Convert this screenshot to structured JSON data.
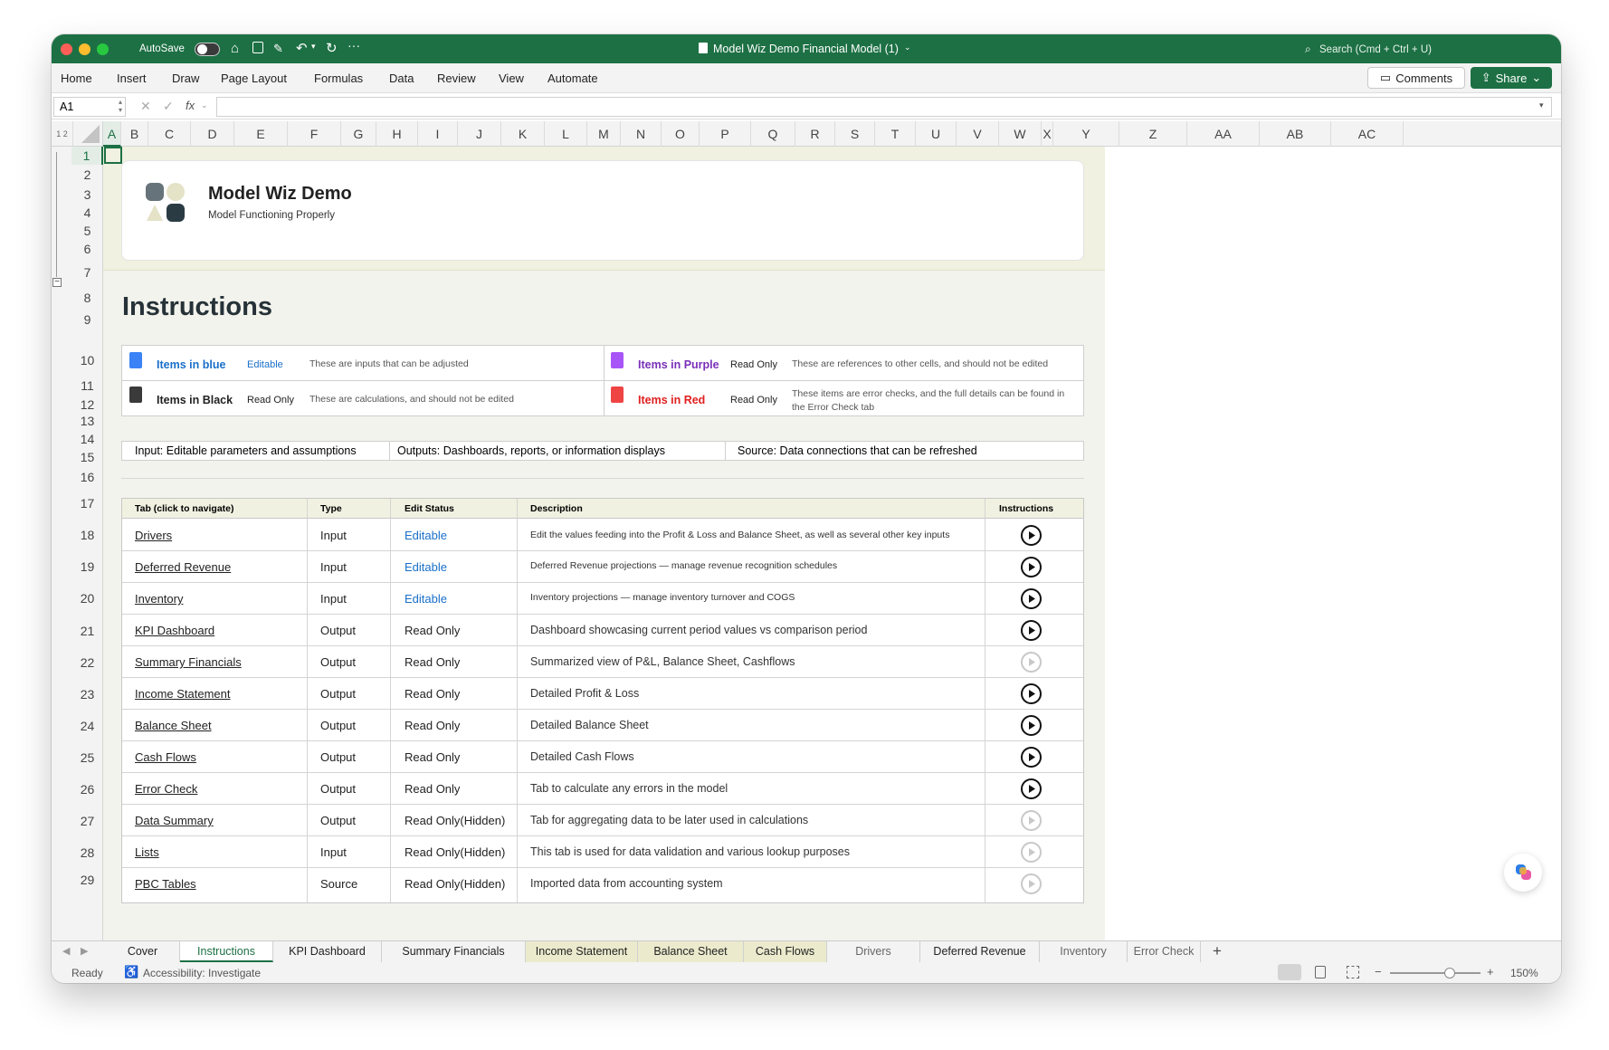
{
  "window": {
    "title": "Model Wiz Demo Financial Model (1)",
    "autosave_label": "AutoSave",
    "search_placeholder": "Search (Cmd + Ctrl + U)"
  },
  "menu": [
    "Home",
    "Insert",
    "Draw",
    "Page Layout",
    "Formulas",
    "Data",
    "Review",
    "View",
    "Automate"
  ],
  "ribbon": {
    "comments_label": "Comments",
    "share_label": "Share"
  },
  "formula_bar": {
    "cell_ref": "A1",
    "fx_label": "fx",
    "value": ""
  },
  "columns": [
    "A",
    "B",
    "C",
    "D",
    "E",
    "F",
    "G",
    "H",
    "I",
    "J",
    "K",
    "L",
    "M",
    "N",
    "O",
    "P",
    "Q",
    "R",
    "S",
    "T",
    "U",
    "V",
    "W",
    "X",
    "Y",
    "Z",
    "AA",
    "AB",
    "AC"
  ],
  "rows": [
    "1",
    "2",
    "3",
    "4",
    "5",
    "6",
    "7",
    "8",
    "9",
    "10",
    "11",
    "12",
    "13",
    "14",
    "15",
    "16",
    "17",
    "18",
    "19",
    "20",
    "21",
    "22",
    "23",
    "24",
    "25",
    "26",
    "27",
    "28",
    "29"
  ],
  "outline_levels": [
    "1",
    "2"
  ],
  "header_card": {
    "title": "Model Wiz Demo",
    "subtitle": "Model Functioning Properly"
  },
  "instructions": {
    "heading": "Instructions",
    "legend": [
      {
        "label": "Items in blue",
        "status": "Editable",
        "desc": "These are inputs that can be adjusted",
        "color": "#1a6fc9"
      },
      {
        "label": "Items in Purple",
        "status": "Read Only",
        "desc": "These are references to other cells, and should not be edited",
        "color": "#7a2fb8"
      },
      {
        "label": "Items in Black",
        "status": "Read Only",
        "desc": "These are calculations, and should not be edited",
        "color": "#222222"
      },
      {
        "label": "Items in Red",
        "status": "Read Only",
        "desc": "These items are error checks, and the full details can be found in the Error Check tab",
        "color": "#e02020"
      }
    ],
    "categories": [
      "Input: Editable parameters and assumptions",
      "Outputs: Dashboards, reports, or information displays",
      "Source: Data connections that can be refreshed"
    ]
  },
  "table": {
    "headers": [
      "Tab (click to navigate)",
      "Type",
      "Edit Status",
      "Description",
      "Instructions"
    ],
    "rows": [
      {
        "tab": "Drivers",
        "type": "Input",
        "status": "Editable",
        "desc": "Edit the values feeding into the Profit & Loss and Balance Sheet, as well as several other key inputs",
        "video": true
      },
      {
        "tab": "Deferred Revenue",
        "type": "Input",
        "status": "Editable",
        "desc": "Deferred Revenue projections — manage revenue recognition schedules",
        "video": true
      },
      {
        "tab": "Inventory",
        "type": "Input",
        "status": "Editable",
        "desc": "Inventory projections — manage inventory turnover and COGS",
        "video": true
      },
      {
        "tab": "KPI Dashboard",
        "type": "Output",
        "status": "Read Only",
        "desc": "Dashboard showcasing current period values vs comparison period",
        "video": true
      },
      {
        "tab": "Summary Financials",
        "type": "Output",
        "status": "Read Only",
        "desc": "Summarized view of P&L, Balance Sheet, Cashflows",
        "video": false
      },
      {
        "tab": "Income Statement",
        "type": "Output",
        "status": "Read Only",
        "desc": "Detailed Profit & Loss",
        "video": true
      },
      {
        "tab": "Balance Sheet",
        "type": "Output",
        "status": "Read Only",
        "desc": "Detailed Balance Sheet",
        "video": true
      },
      {
        "tab": "Cash Flows",
        "type": "Output",
        "status": "Read Only",
        "desc": "Detailed Cash Flows",
        "video": true
      },
      {
        "tab": "Error Check",
        "type": "Output",
        "status": "Read Only",
        "desc": "Tab to calculate any errors in the model",
        "video": true
      },
      {
        "tab": "Data Summary",
        "type": "Output",
        "status": "Read Only(Hidden)",
        "desc": "Tab for aggregating data to be later used in calculations",
        "video": false
      },
      {
        "tab": "Lists",
        "type": "Input",
        "status": "Read Only(Hidden)",
        "desc": "This tab is used for data validation and various lookup purposes",
        "video": false
      },
      {
        "tab": "PBC Tables",
        "type": "Source",
        "status": "Read Only(Hidden)",
        "desc": "Imported data from accounting system",
        "video": false
      }
    ]
  },
  "sheet_tabs": [
    "Cover",
    "Instructions",
    "KPI Dashboard",
    "Summary Financials",
    "Income Statement",
    "Balance Sheet",
    "Cash Flows",
    "Drivers",
    "Deferred Revenue",
    "Inventory",
    "Error Check"
  ],
  "active_tab": "Instructions",
  "status_bar": {
    "ready": "Ready",
    "accessibility": "Accessibility: Investigate",
    "zoom": "150%"
  },
  "colors": {
    "excel_green": "#1d7044",
    "editable_blue": "#1a6fc9",
    "purple": "#7a2fb8",
    "red": "#e02020",
    "sheet_bg": "#f2f3ec",
    "header_bg": "#f0f1e0"
  }
}
